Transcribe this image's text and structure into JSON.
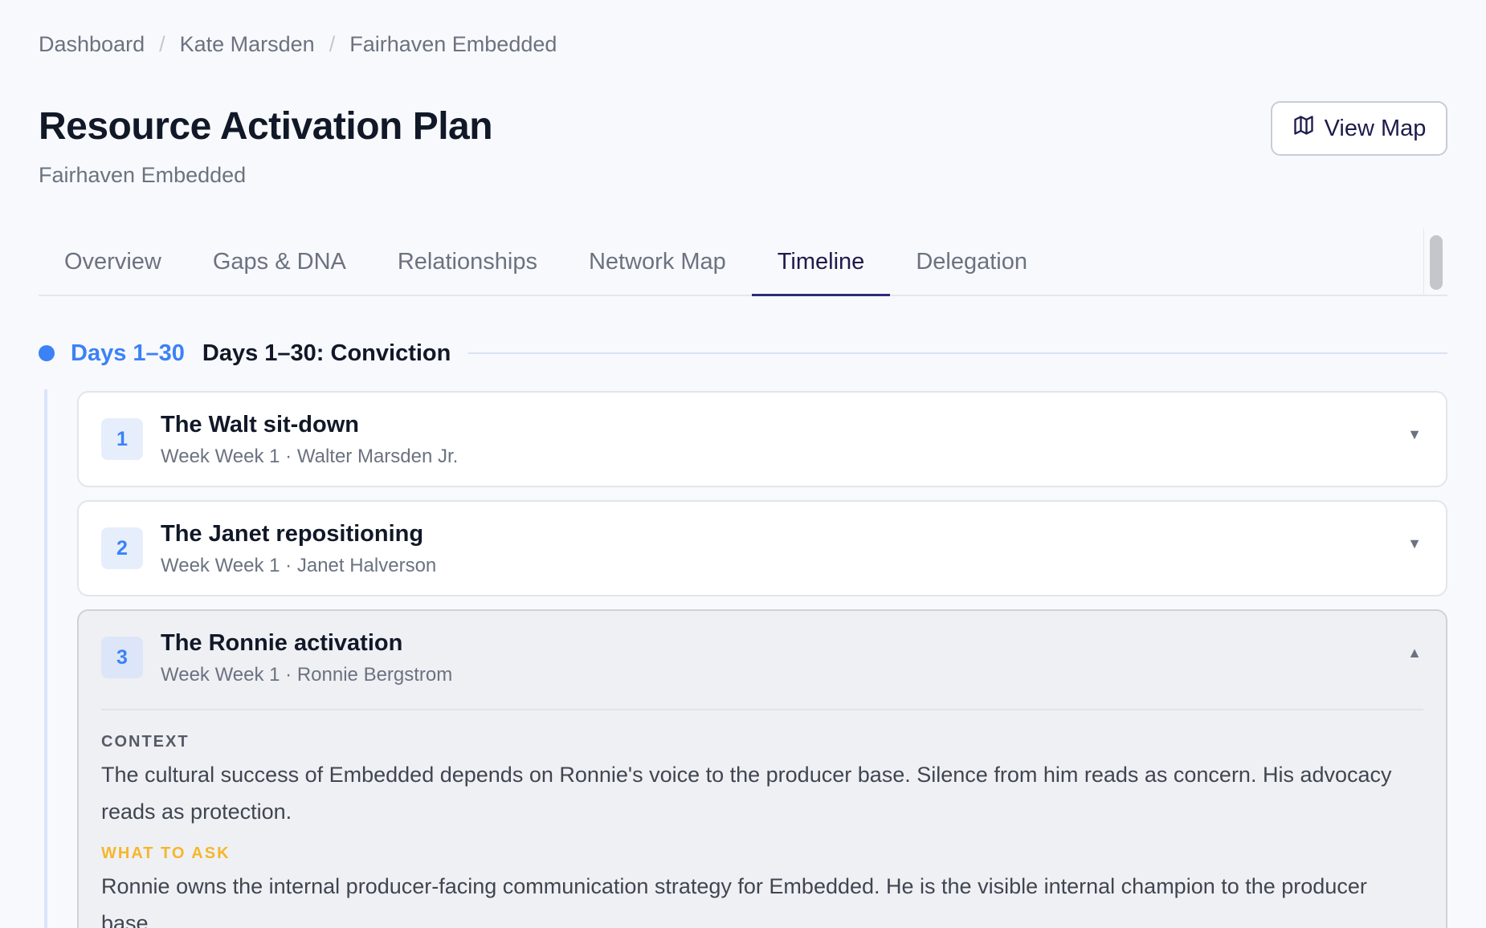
{
  "breadcrumb": {
    "items": [
      "Dashboard",
      "Kate Marsden",
      "Fairhaven Embedded"
    ],
    "separator": "/"
  },
  "header": {
    "title": "Resource Activation Plan",
    "subtitle": "Fairhaven Embedded",
    "view_map_label": "View Map",
    "view_map_icon": "map-icon"
  },
  "tabs": [
    {
      "label": "Overview",
      "active": false
    },
    {
      "label": "Gaps & DNA",
      "active": false
    },
    {
      "label": "Relationships",
      "active": false
    },
    {
      "label": "Network Map",
      "active": false
    },
    {
      "label": "Timeline",
      "active": true
    },
    {
      "label": "Delegation",
      "active": false
    }
  ],
  "phase": {
    "days": "Days 1–30",
    "title": "Days 1–30: Conviction",
    "accent_color": "#3b82f6"
  },
  "steps": [
    {
      "number": "1",
      "title": "The Walt sit-down",
      "meta": "Week Week 1 · Walter Marsden Jr.",
      "expanded": false
    },
    {
      "number": "2",
      "title": "The Janet repositioning",
      "meta": "Week Week 1 · Janet Halverson",
      "expanded": false
    },
    {
      "number": "3",
      "title": "The Ronnie activation",
      "meta": "Week Week 1 · Ronnie Bergstrom",
      "expanded": true,
      "context_label": "CONTEXT",
      "context_text": "The cultural success of Embedded depends on Ronnie's voice to the producer base. Silence from him reads as concern. His advocacy reads as protection.",
      "ask_label": "WHAT TO ASK",
      "ask_text": "Ronnie owns the internal producer-facing communication strategy for Embedded. He is the visible internal champion to the producer base."
    }
  ],
  "colors": {
    "primary": "#1e1b4b",
    "accent": "#3b82f6",
    "ask_label": "#f5b62a"
  }
}
